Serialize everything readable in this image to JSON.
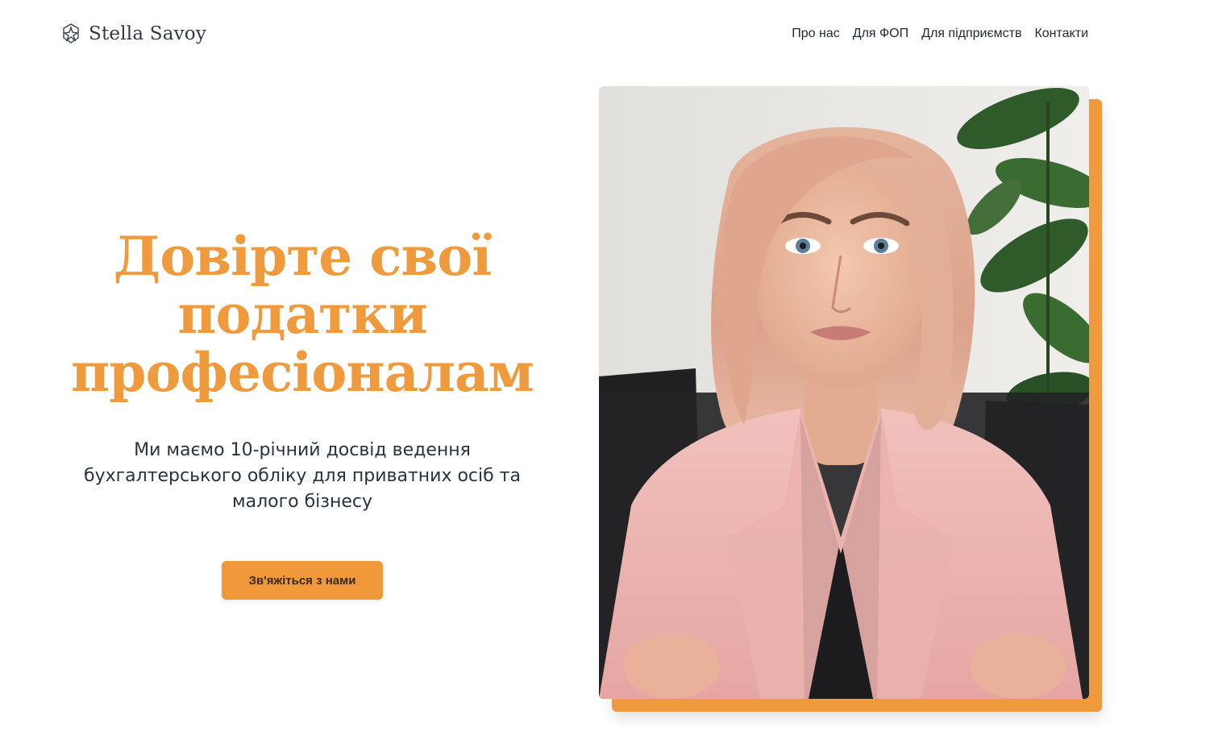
{
  "brand": {
    "name": "Stella Savoy",
    "logo_icon": "hexagon-star-logo-icon"
  },
  "nav": {
    "items": [
      {
        "label": "Про нас"
      },
      {
        "label": "Для ФОП"
      },
      {
        "label": "Для підприємств"
      },
      {
        "label": "Контакти"
      }
    ]
  },
  "hero": {
    "title_lines": [
      "Довірте свої",
      "податки",
      "професіоналам"
    ],
    "subtitle": "Ми маємо 10-річний досвід ведення бухгалтерського обліку для приватних осіб та малого бізнесу",
    "cta_label": "Зв'яжіться з нами"
  },
  "photo": {
    "subject": "portrait-of-woman-in-pink-blazer"
  },
  "colors": {
    "accent": "#ef9a3d",
    "text_dark": "#283340",
    "blazer_pink": "#e9aaa8",
    "hair": "#dba284",
    "sofa": "#1f2022",
    "wall": "#e8e6e2",
    "plant": "#2f5a2a"
  }
}
